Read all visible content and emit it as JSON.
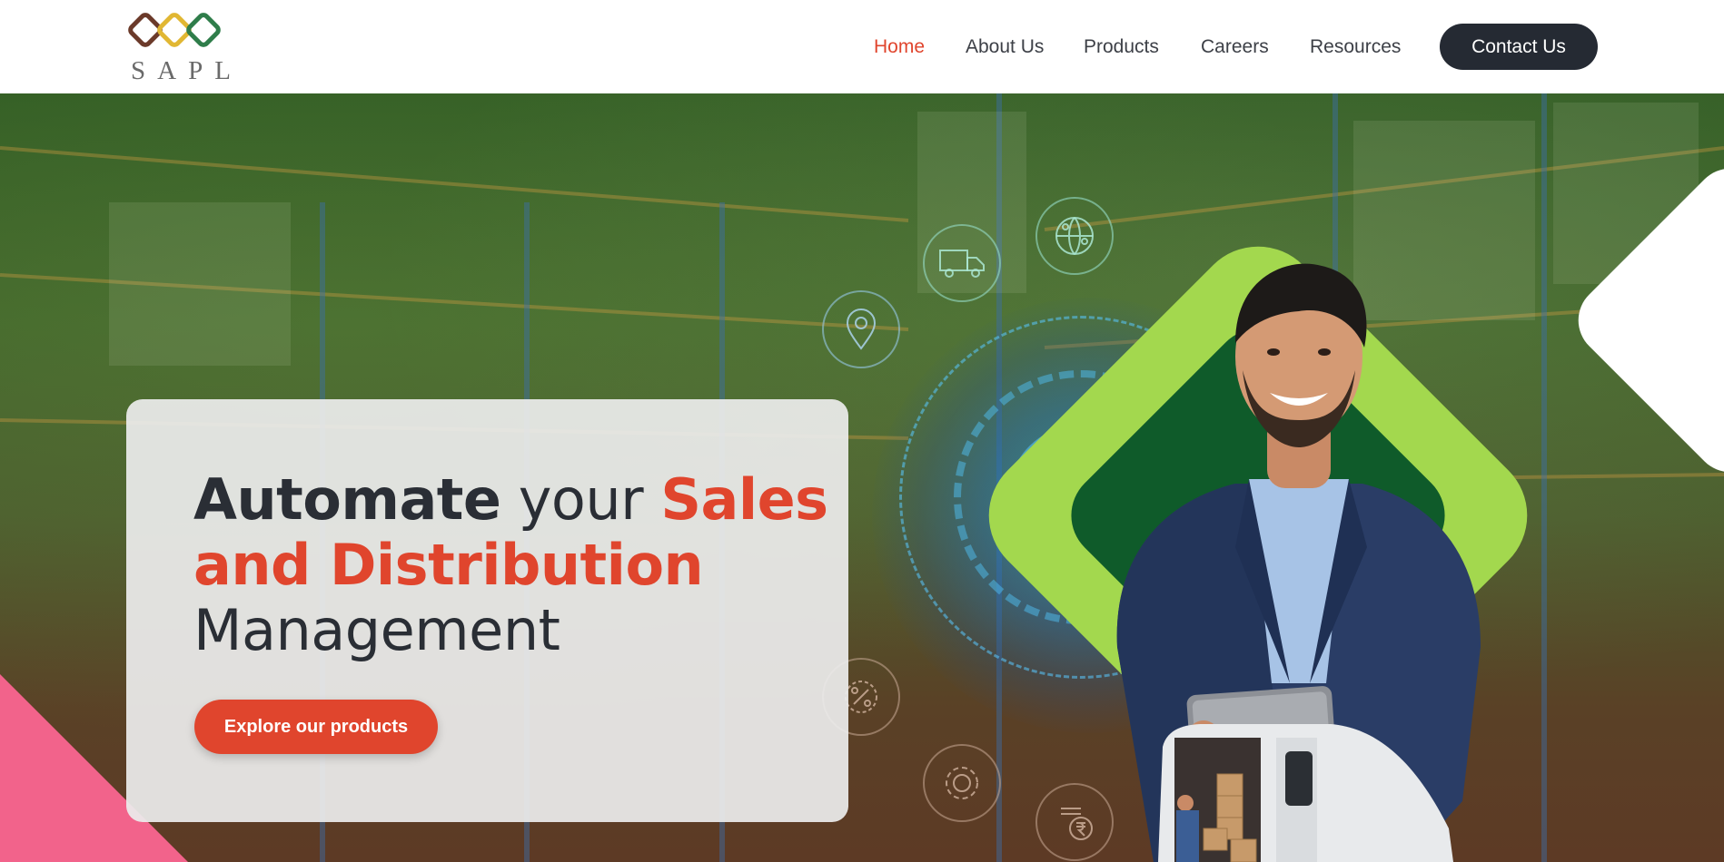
{
  "brand": {
    "logo_text": "SAPL"
  },
  "nav": {
    "items": [
      {
        "label": "Home",
        "active": true
      },
      {
        "label": "About Us"
      },
      {
        "label": "Products"
      },
      {
        "label": "Careers"
      },
      {
        "label": "Resources"
      }
    ],
    "cta": "Contact Us"
  },
  "hero": {
    "headline": {
      "w1": "Automate",
      "w2": "your",
      "w3": "Sales",
      "w4": "and Distribution",
      "w5": "Management"
    },
    "button": "Explore our products"
  },
  "icons": [
    "truck-icon",
    "globe-network-icon",
    "location-pin-icon",
    "discount-badge-icon",
    "gear-icon",
    "rupee-invoice-icon"
  ],
  "colors": {
    "accent": "#e0452d",
    "dark": "#252a33",
    "lime": "#a3d84e",
    "forest": "#0f5b2a",
    "pink": "#f2638b"
  }
}
